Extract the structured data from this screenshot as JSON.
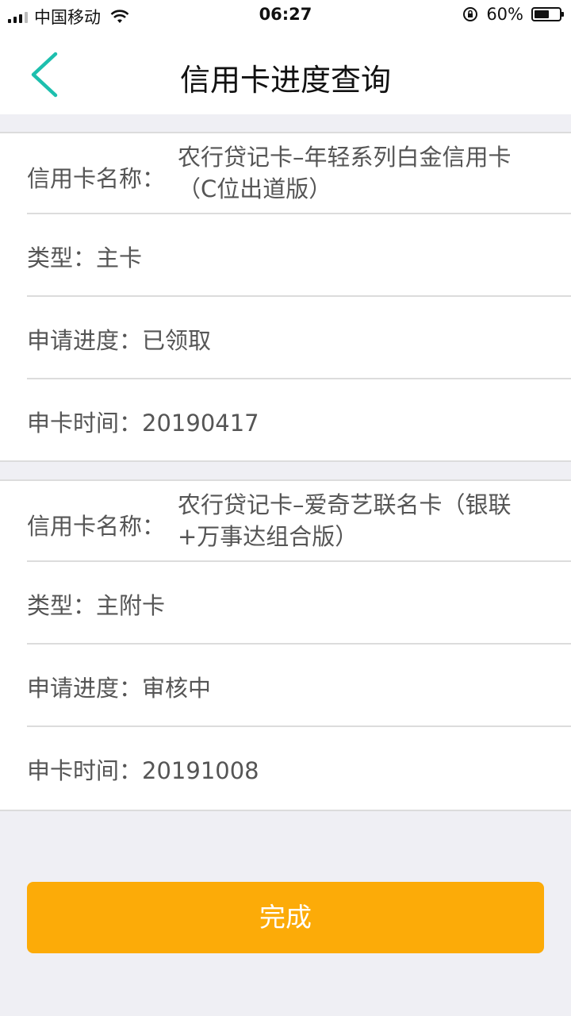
{
  "status_bar": {
    "carrier": "中国移动",
    "time": "06:27",
    "battery_text": "60%",
    "battery_level": 0.6
  },
  "nav": {
    "title": "信用卡进度查询",
    "back_icon": "chevron-left-icon",
    "accent_color": "#1dbfae"
  },
  "cards": [
    {
      "name_label": "信用卡名称：",
      "name_value": "农行贷记卡–年轻系列白金信用卡（C位出道版）",
      "type_label": "类型：",
      "type_value": "主卡",
      "progress_label": "申请进度：",
      "progress_value": "已领取",
      "date_label": "申卡时间：",
      "date_value": "20190417"
    },
    {
      "name_label": "信用卡名称：",
      "name_value": "农行贷记卡–爱奇艺联名卡（银联+万事达组合版）",
      "type_label": "类型：",
      "type_value": "主附卡",
      "progress_label": "申请进度：",
      "progress_value": "审核中",
      "date_label": "申卡时间：",
      "date_value": "20191008"
    }
  ],
  "done_button": {
    "label": "完成",
    "color": "#fcab08"
  }
}
